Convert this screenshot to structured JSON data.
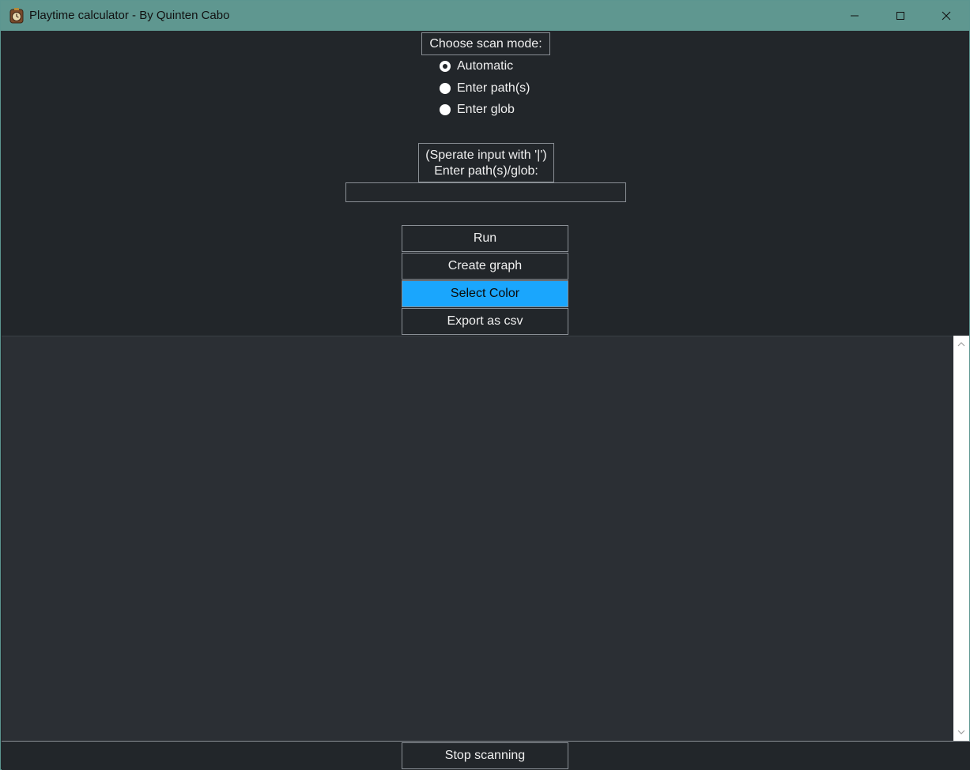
{
  "window": {
    "title": "Playtime calculator - By Quinten Cabo"
  },
  "scan_mode": {
    "label": "Choose scan mode:",
    "options": [
      {
        "label": "Automatic",
        "selected": true
      },
      {
        "label": "Enter path(s)",
        "selected": false
      },
      {
        "label": "Enter glob",
        "selected": false
      }
    ]
  },
  "path_entry": {
    "label_line1": "(Sperate input with '|')",
    "label_line2": "Enter path(s)/glob:",
    "value": ""
  },
  "actions": {
    "run": "Run",
    "create_graph": "Create graph",
    "select_color": "Select Color",
    "export_csv": "Export as csv"
  },
  "bottom": {
    "stop_scanning": "Stop scanning"
  },
  "colors": {
    "titlebar": "#5f9790",
    "background": "#22262a",
    "output_background": "#2b2f34",
    "accent": "#1aa6fd",
    "text": "#f0f0f0"
  },
  "icons": {
    "app": "clock-app-icon",
    "minimize": "minimize-icon",
    "maximize": "maximize-icon",
    "close": "close-icon",
    "scroll_up": "chevron-up-icon",
    "scroll_down": "chevron-down-icon"
  }
}
